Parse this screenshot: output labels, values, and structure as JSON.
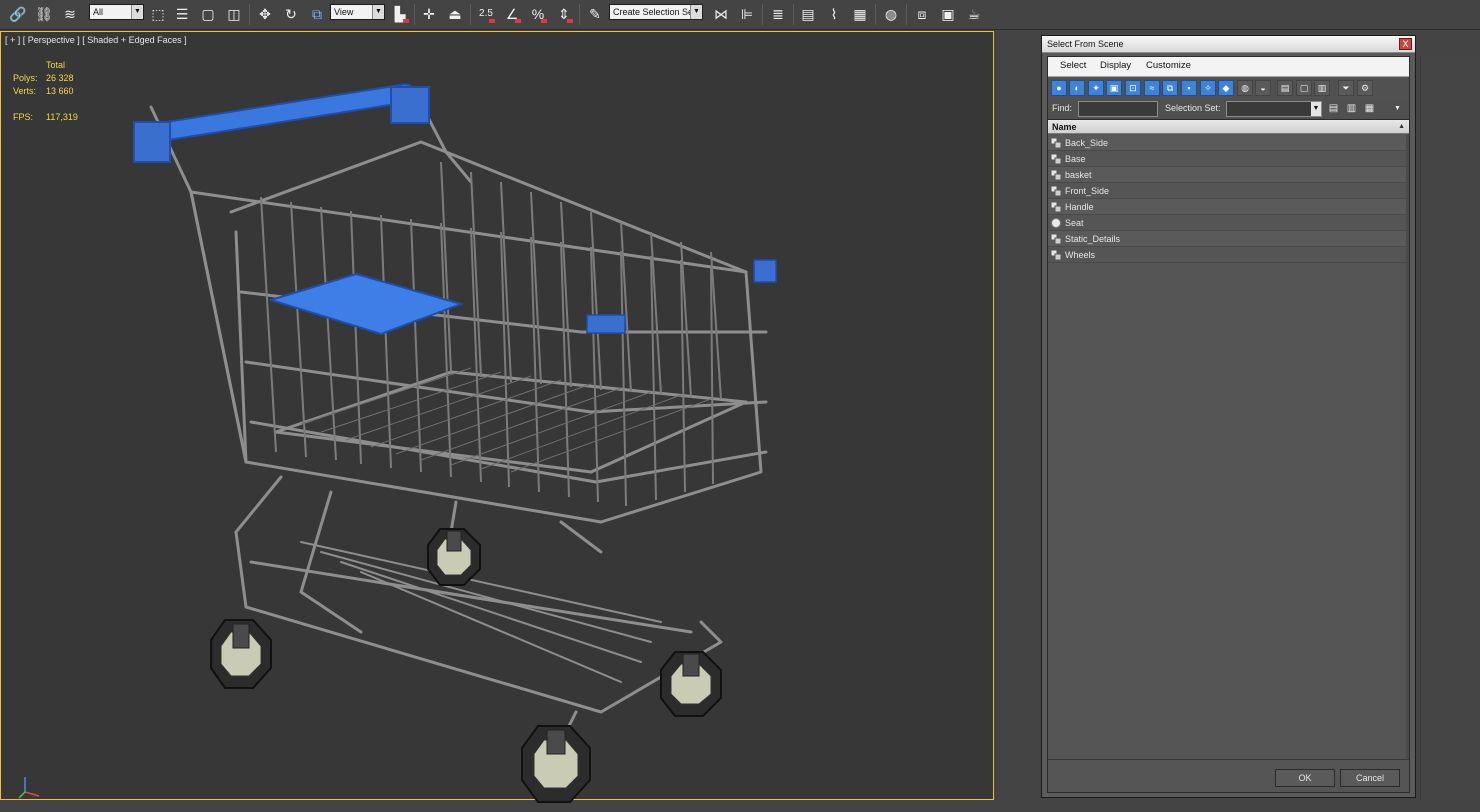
{
  "toolbar": {
    "filter_dropdown": "All",
    "refcoord_dropdown": "View",
    "snap_label": "2.5",
    "selection_set": "Create Selection Se"
  },
  "viewport": {
    "label": "[ + ] [ Perspective ] [ Shaded + Edged Faces ]",
    "stats": {
      "total_label": "Total",
      "polys_label": "Polys:",
      "polys_value": "26 328",
      "verts_label": "Verts:",
      "verts_value": "13 660",
      "fps_label": "FPS:",
      "fps_value": "117,319"
    },
    "colors": {
      "wire": "#8a8a8a",
      "blue": "#3a78e0",
      "background": "#373737",
      "stat_text": "#f1d84a"
    }
  },
  "dialog": {
    "title": "Select From Scene",
    "close": "X",
    "menu": [
      "Select",
      "Display",
      "Customize"
    ],
    "find_label": "Find:",
    "find_value": "",
    "selset_label": "Selection Set:",
    "selset_value": "",
    "column_name": "Name",
    "items": [
      {
        "name": "Back_Side",
        "icon": "group-icon"
      },
      {
        "name": "Base",
        "icon": "group-icon"
      },
      {
        "name": "basket",
        "icon": "group-icon"
      },
      {
        "name": "Front_Side",
        "icon": "group-icon"
      },
      {
        "name": "Handle",
        "icon": "group-icon"
      },
      {
        "name": "Seat",
        "icon": "sphere-icon"
      },
      {
        "name": "Static_Details",
        "icon": "group-icon"
      },
      {
        "name": "Wheels",
        "icon": "group-icon"
      }
    ],
    "ok": "OK",
    "cancel": "Cancel"
  }
}
